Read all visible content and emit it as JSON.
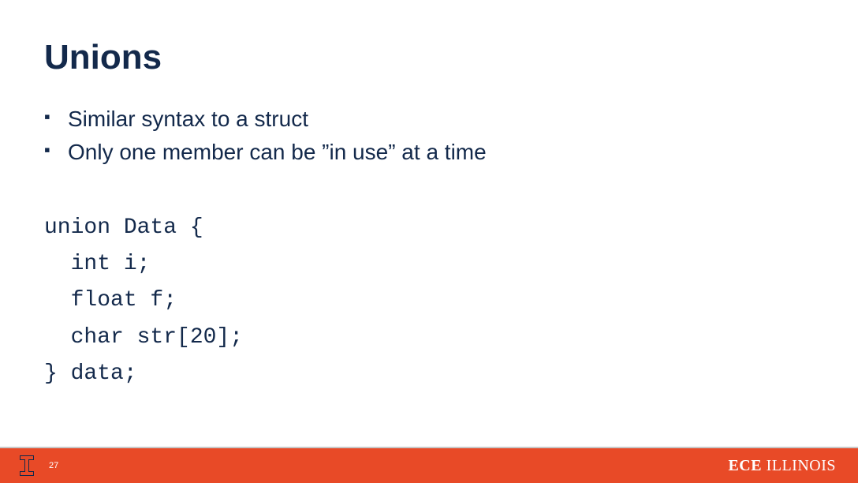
{
  "title": "Unions",
  "bullets": [
    "Similar syntax to a struct",
    "Only one member can be ”in use” at a time"
  ],
  "code": "union Data {\n  int i;\n  float f;\n  char str[20];\n} data;",
  "footer": {
    "page_number": "27",
    "dept_prefix": "ECE",
    "dept_suffix": " ILLINOIS"
  }
}
